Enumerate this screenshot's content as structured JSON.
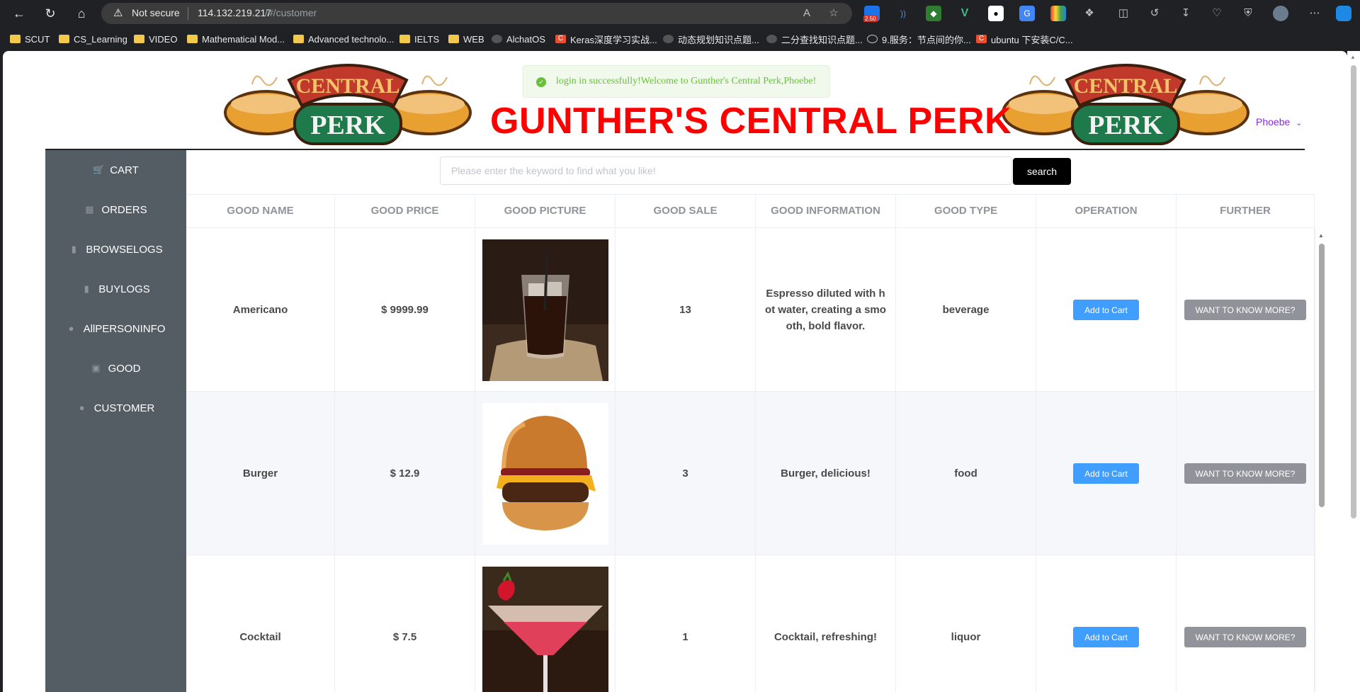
{
  "browser": {
    "security_label": "Not secure",
    "url_host": "114.132.219.217",
    "url_path": "/#/customer",
    "ext_badge": "2.50",
    "bookmarks": [
      {
        "label": "SCUT",
        "icon": "folder-icon"
      },
      {
        "label": "CS_Learning",
        "icon": "folder-icon"
      },
      {
        "label": "VIDEO",
        "icon": "folder-icon"
      },
      {
        "label": "Mathematical Mod...",
        "icon": "folder-icon"
      },
      {
        "label": "Advanced technolo...",
        "icon": "folder-icon"
      },
      {
        "label": "IELTS",
        "icon": "folder-icon"
      },
      {
        "label": "WEB",
        "icon": "folder-icon"
      },
      {
        "label": "AlchatOS",
        "icon": "openai-icon"
      },
      {
        "label": "Keras深度学习实战...",
        "icon": "csdn-icon"
      },
      {
        "label": "动态规划知识点题...",
        "icon": "site-icon"
      },
      {
        "label": "二分查找知识点题...",
        "icon": "site-icon"
      },
      {
        "label": "9.服务：节点间的你...",
        "icon": "globe-icon"
      },
      {
        "label": "ubuntu 下安装C/C...",
        "icon": "csdn-icon"
      }
    ]
  },
  "header": {
    "title": "GUNTHER'S CENTRAL PERK",
    "toast": "login in successfully!Welcome to Gunther's Central Perk,Phoebe!",
    "user": "Phoebe",
    "logo_top": "CENTRAL",
    "logo_bottom": "PERK"
  },
  "sidebar": {
    "items": [
      {
        "label": "CART",
        "icon": "cart-icon"
      },
      {
        "label": "ORDERS",
        "icon": "clipboard-icon"
      },
      {
        "label": "BROWSELOGS",
        "icon": "bar-chart-icon"
      },
      {
        "label": "BUYLOGS",
        "icon": "bar-chart-icon"
      },
      {
        "label": "AllPERSONINFO",
        "icon": "user-icon"
      },
      {
        "label": "GOOD",
        "icon": "bag-icon"
      },
      {
        "label": "CUSTOMER",
        "icon": "user-icon"
      }
    ]
  },
  "search": {
    "placeholder": "Please enter the keyword to find what you like!",
    "button": "search"
  },
  "table": {
    "columns": [
      "GOOD NAME",
      "GOOD PRICE",
      "GOOD PICTURE",
      "GOOD SALE",
      "GOOD INFORMATION",
      "GOOD TYPE",
      "OPERATION",
      "FURTHER"
    ],
    "add_label": "Add to Cart",
    "more_label": "WANT TO KNOW MORE?",
    "rows": [
      {
        "name": "Americano",
        "price": "$ 9999.99",
        "picture": "iced-americano-photo",
        "sale": "13",
        "info": "Espresso diluted with hot water, creating a smooth, bold flavor.",
        "type": "beverage"
      },
      {
        "name": "Burger",
        "price": "$ 12.9",
        "picture": "cheeseburger-photo",
        "sale": "3",
        "info": "Burger, delicious!",
        "type": "food"
      },
      {
        "name": "Cocktail",
        "price": "$ 7.5",
        "picture": "cocktail-photo",
        "sale": "1",
        "info": "Cocktail, refreshing!",
        "type": "liquor"
      }
    ]
  },
  "colors": {
    "title_red": "#ff0000",
    "sidebar_bg": "#545c64",
    "primary_blue": "#409eff",
    "success_green": "#67c23a",
    "gray_button": "#909399",
    "user_purple": "#8a2be2"
  }
}
